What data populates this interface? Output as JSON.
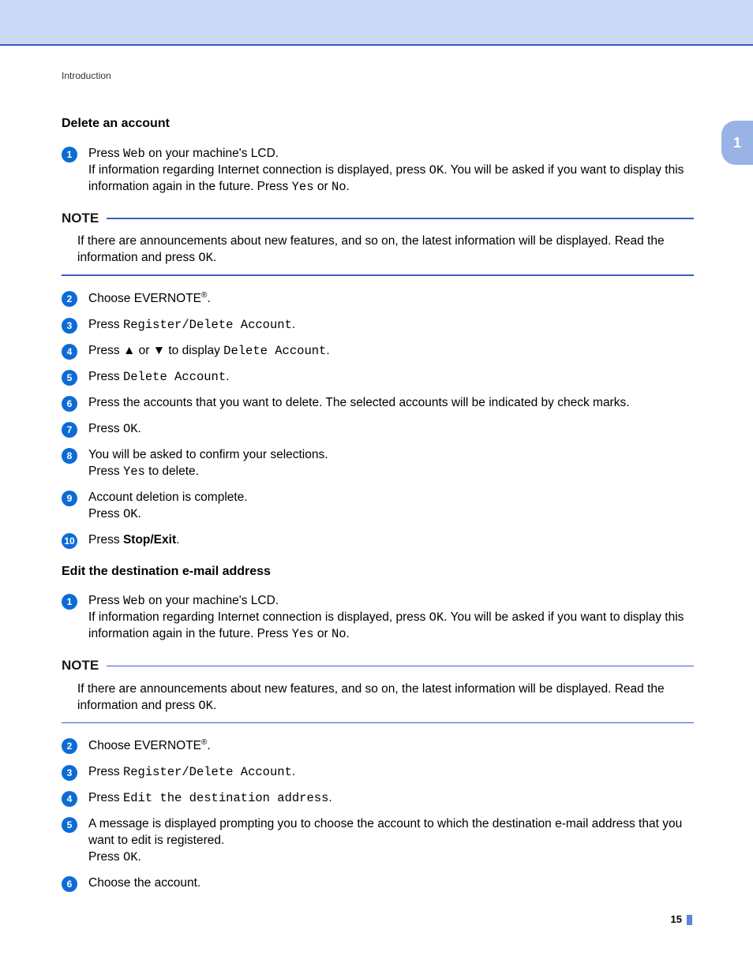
{
  "section_label": "Introduction",
  "tab_number": "1",
  "page_number": "15",
  "note_label": "NOTE",
  "note_text_prefix": "If there are announcements about new features, and so on, the latest information will be displayed. Read the information and press ",
  "note_text_ok": "OK",
  "note_text_suffix": ".",
  "sec1": {
    "heading": "Delete an account",
    "s1": {
      "num": "1",
      "t1": "Press ",
      "m1": "Web",
      "t2": " on your machine's LCD.",
      "t3": "If information regarding Internet connection is displayed, press ",
      "m2": "OK",
      "t4": ". You will be asked if you want to display this information again in the future. Press ",
      "m3": "Yes",
      "t5": " or ",
      "m4": "No",
      "t6": "."
    },
    "s2": {
      "num": "2",
      "t1": "Choose EVERNOTE",
      "sup": "®",
      "t2": "."
    },
    "s3": {
      "num": "3",
      "t1": "Press ",
      "m1": "Register/Delete Account",
      "t2": "."
    },
    "s4": {
      "num": "4",
      "t1": "Press ",
      "a1": "▲",
      "t2": " or ",
      "a2": "▼",
      "t3": " to display ",
      "m1": "Delete Account",
      "t4": "."
    },
    "s5": {
      "num": "5",
      "t1": "Press ",
      "m1": "Delete Account",
      "t2": "."
    },
    "s6": {
      "num": "6",
      "t1": "Press the accounts that you want to delete. The selected accounts will be indicated by check marks."
    },
    "s7": {
      "num": "7",
      "t1": "Press ",
      "m1": "OK",
      "t2": "."
    },
    "s8": {
      "num": "8",
      "t1": "You will be asked to confirm your selections.",
      "t2": "Press ",
      "m1": "Yes",
      "t3": " to delete."
    },
    "s9": {
      "num": "9",
      "t1": "Account deletion is complete.",
      "t2": "Press ",
      "m1": "OK",
      "t3": "."
    },
    "s10": {
      "num": "10",
      "t1": "Press ",
      "b1": "Stop/Exit",
      "t2": "."
    }
  },
  "sec2": {
    "heading": "Edit the destination e-mail address",
    "s1": {
      "num": "1",
      "t1": "Press ",
      "m1": "Web",
      "t2": " on your machine's LCD.",
      "t3": "If information regarding Internet connection is displayed, press ",
      "m2": "OK",
      "t4": ". You will be asked if you want to display this information again in the future. Press ",
      "m3": "Yes",
      "t5": " or ",
      "m4": "No",
      "t6": "."
    },
    "s2": {
      "num": "2",
      "t1": "Choose EVERNOTE",
      "sup": "®",
      "t2": "."
    },
    "s3": {
      "num": "3",
      "t1": "Press ",
      "m1": "Register/Delete Account",
      "t2": "."
    },
    "s4": {
      "num": "4",
      "t1": "Press ",
      "m1": "Edit the destination address",
      "t2": "."
    },
    "s5": {
      "num": "5",
      "t1": "A message is displayed prompting you to choose the account to which the destination e-mail address that you want to edit is registered.",
      "t2": "Press ",
      "m1": "OK",
      "t3": "."
    },
    "s6": {
      "num": "6",
      "t1": "Choose the account."
    }
  }
}
